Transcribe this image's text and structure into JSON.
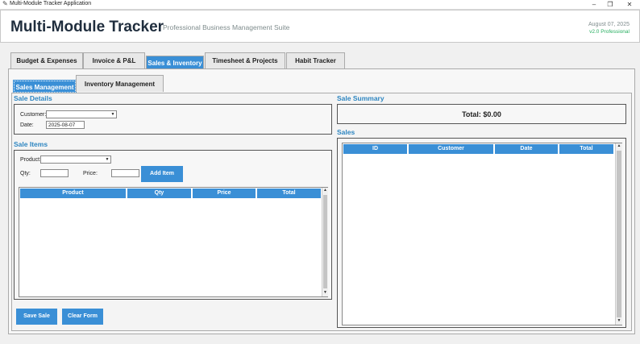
{
  "window": {
    "title": "Multi-Module Tracker Application",
    "minimize": "–",
    "maximize": "❐",
    "close": "✕",
    "app_icon": "feather-icon"
  },
  "header": {
    "title": "Multi-Module Tracker",
    "subtitle": "Professional Business Management Suite",
    "date": "August 07, 2025",
    "version": "v2.0 Professional"
  },
  "tabs": [
    "Budget & Expenses",
    "Invoice & P&L",
    "Sales & Inventory",
    "Timesheet & Projects",
    "Habit Tracker"
  ],
  "active_tab": "Sales & Inventory",
  "subtabs": [
    "Sales Management",
    "Inventory Management"
  ],
  "sale_details": {
    "title": "Sale Details",
    "customer_label": "Customer:",
    "customer_value": "",
    "date_label": "Date:",
    "date_value": "2025-08-07"
  },
  "sale_items": {
    "title": "Sale Items",
    "product_label": "Product:",
    "product_value": "",
    "qty_label": "Qty:",
    "qty_value": "",
    "price_label": "Price:",
    "price_value": "",
    "add_button": "Add Item",
    "columns": [
      "Product",
      "Qty",
      "Price",
      "Total"
    ]
  },
  "actions": {
    "save": "Save Sale",
    "clear": "Clear Form"
  },
  "sale_summary": {
    "title": "Sale Summary",
    "total": "Total: $0.00"
  },
  "sales": {
    "title": "Sales",
    "columns": [
      "ID",
      "Customer",
      "Date",
      "Total"
    ]
  },
  "colors": {
    "accent": "#3a8fd6",
    "section_title": "#2e86c1",
    "version": "#27ae60"
  }
}
